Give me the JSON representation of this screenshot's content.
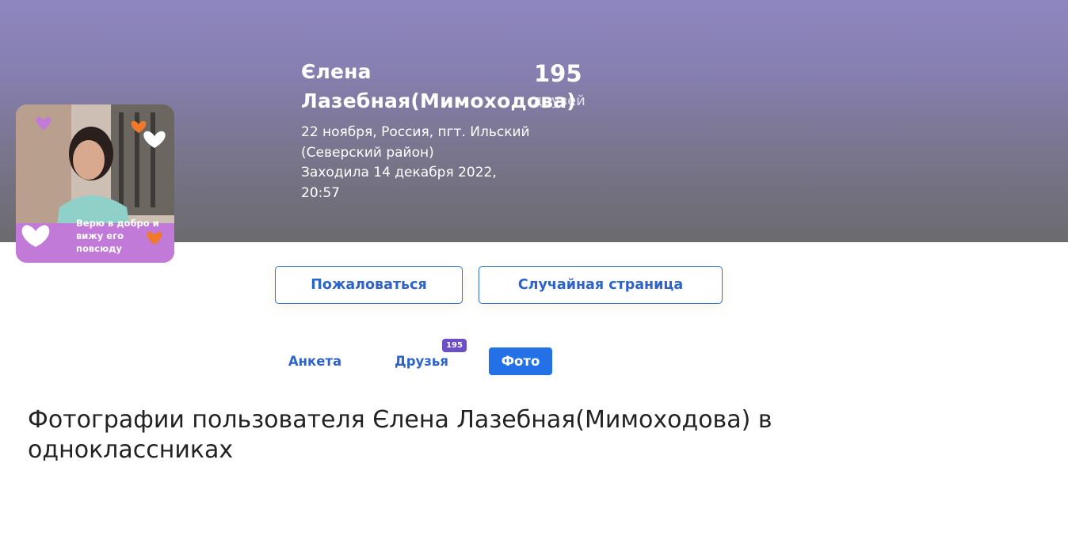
{
  "profile": {
    "name": "Єлена Лазебная(Мимоходова)",
    "birthday_location": "22 ноября, Россия, пгт. Ильский (Северский район)",
    "last_seen": "Заходила 14 декабря 2022, 20:57",
    "friends_count": "195",
    "friends_label": "друзей",
    "avatar_caption": "Верю в добро и вижу его повсюду"
  },
  "actions": {
    "complain_label": "Пожаловаться",
    "random_label": "Случайная страница"
  },
  "tabs": [
    {
      "label": "Анкета",
      "active": false
    },
    {
      "label": "Друзья",
      "active": false,
      "badge": "195"
    },
    {
      "label": "Фото",
      "active": true
    }
  ],
  "page": {
    "heading": "Фотографии пользователя Єлена Лазебная(Мимоходова) в одноклассниках"
  },
  "colors": {
    "accent": "#2470e6",
    "badge": "#6a4fc8",
    "link": "#2e64c8"
  }
}
